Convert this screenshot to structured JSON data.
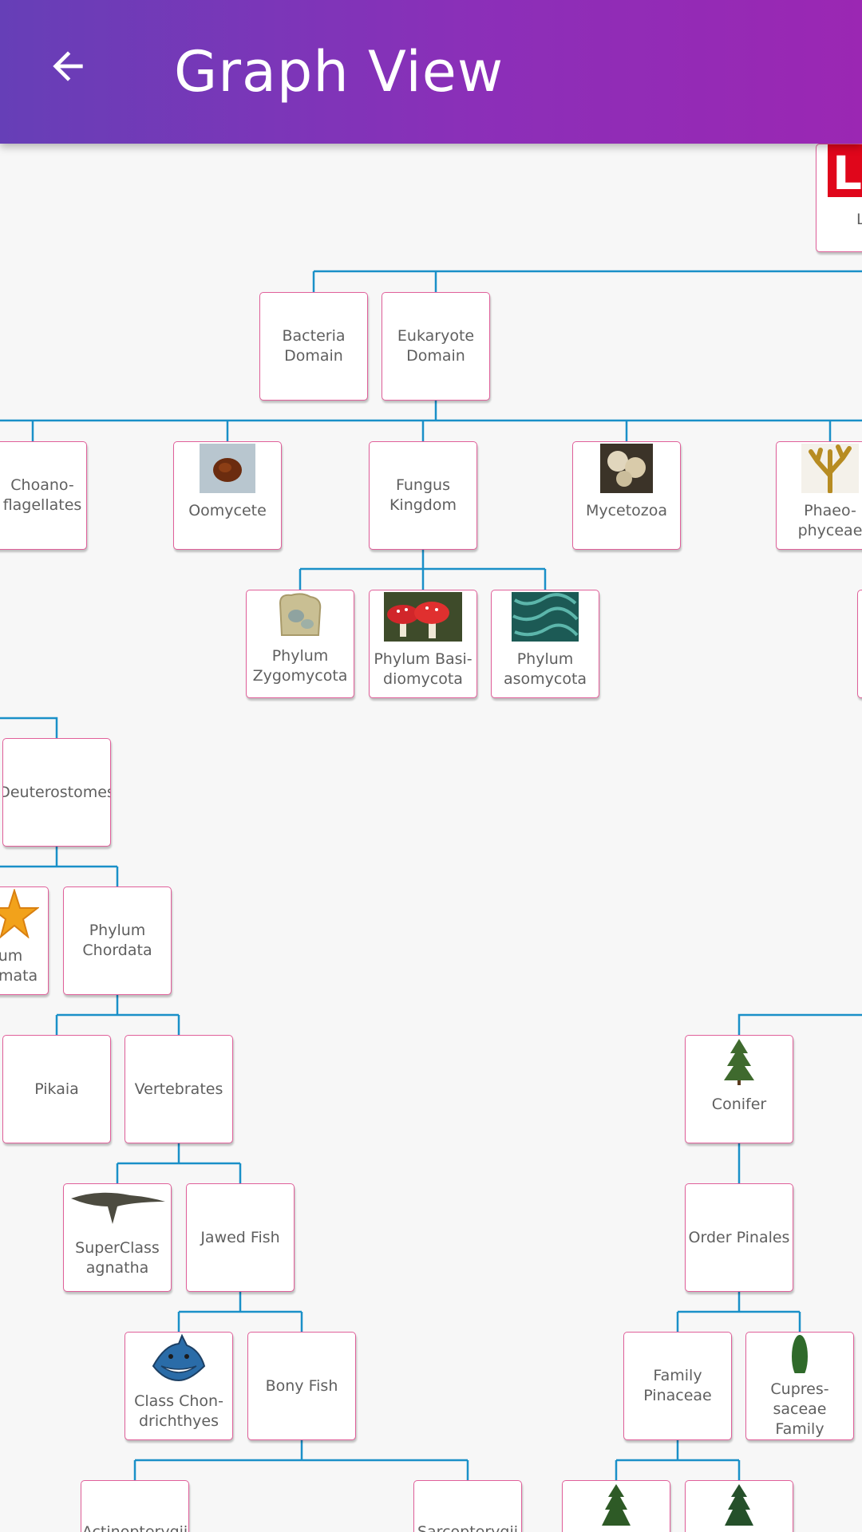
{
  "header": {
    "title": "Graph View",
    "back_icon": "arrow-back-icon"
  },
  "colors": {
    "appbar_start": "#663fb7",
    "appbar_end": "#9b27b3",
    "edge": "#1a90c8",
    "node_border": "#e0609a"
  },
  "nodes": {
    "top_partial": "L",
    "bacteria_domain": "Bacteria\nDomain",
    "eukaryote_domain": "Eukaryote\nDomain",
    "choanoflagellates": "Choano-\nflagellates",
    "oomycete": "Oomycete",
    "fungus_kingdom": "Fungus\nKingdom",
    "mycetozoa": "Mycetozoa",
    "phaeophyceae": "Phaeo-\nphyceae",
    "phylum_zygomycota": "Phylum\nZygomycota",
    "phylum_basidiomycota": "Phylum Basi-\ndiomycota",
    "phylum_ascomycota": "Phylum\nasomycota",
    "deuterostomes": "Deuterostomes",
    "phylum_echinodermata": "um\nermata",
    "phylum_chordata": "Phylum\nChordata",
    "pikaia": "Pikaia",
    "vertebrates": "Vertebrates",
    "superclass_agnatha": "SuperClass\nagnatha",
    "jawed_fish": "Jawed Fish",
    "class_chondrichthyes": "Class Chon-\ndrichthyes",
    "bony_fish": "Bony Fish",
    "conifer": "Conifer",
    "order_pinales": "Order Pinales",
    "family_pinaceae": "Family\nPinaceae",
    "cupressaceae_family": "Cupres-\nsaceae\nFamily",
    "actinopterygii_partial": "Actinopterygii",
    "sarcopterygii_partial": "Sarcopterygii"
  },
  "images": {
    "oomycete": "oomycete-photo",
    "mycetozoa": "slime-mold-photo",
    "phaeophyceae": "brown-algae-photo",
    "phylum_zygomycota": "moldy-bread-photo",
    "phylum_basidiomycota": "red-mushroom-photo",
    "phylum_ascomycota": "green-filament-photo",
    "phylum_echinodermata": "starfish-photo",
    "superclass_agnatha": "jawless-fish-photo",
    "class_chondrichthyes": "shark-cartoon",
    "conifer": "conifer-tree-photo",
    "cupressaceae_family": "cypress-tree-photo"
  }
}
